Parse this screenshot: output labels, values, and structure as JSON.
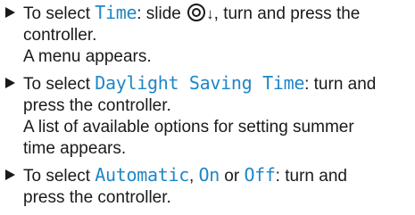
{
  "steps": [
    {
      "lines": [
        {
          "pre": "To select ",
          "hl": "Time",
          "post": ": slide ",
          "controller_arrow": "↓",
          "tail": ", turn and press the"
        },
        {
          "text": "controller."
        },
        {
          "text": "A menu appears."
        }
      ]
    },
    {
      "lines": [
        {
          "pre": "To select ",
          "hl": "Daylight Saving Time",
          "post": ": turn and"
        },
        {
          "text": "press the controller."
        },
        {
          "text": "A list of available options for setting summer"
        },
        {
          "text": "time appears."
        }
      ]
    },
    {
      "lines": [
        {
          "pre": "To select ",
          "hl1": "Automatic",
          "sep1": ", ",
          "hl2": "On",
          "sep2": " or ",
          "hl3": "Off",
          "post": ": turn and"
        },
        {
          "text": "press the controller."
        }
      ]
    }
  ],
  "icons": {
    "bullet": "triangle-bullet-icon",
    "controller": "controller-dial-icon"
  },
  "colors": {
    "highlight": "#1f86c8",
    "text": "#1a1a1a"
  }
}
